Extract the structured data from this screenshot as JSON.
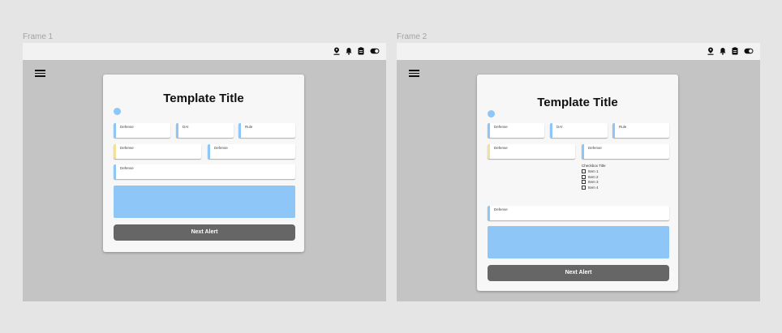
{
  "frames": [
    {
      "label": "Frame 1",
      "icons": [
        "map-pin-icon",
        "bell-icon",
        "clipboard-icon",
        "toggle-icon"
      ],
      "card": {
        "title": "Template Title",
        "fields": [
          {
            "label": "Defense"
          },
          {
            "label": "DAI"
          },
          {
            "label": "Rule"
          },
          {
            "label": "Defense"
          },
          {
            "label": "Defense"
          },
          {
            "label": "Defense"
          }
        ],
        "button": "Next Alert"
      }
    },
    {
      "label": "Frame 2",
      "icons": [
        "map-pin-icon",
        "bell-icon",
        "clipboard-icon",
        "toggle-icon"
      ],
      "card": {
        "title": "Template Title",
        "fields": [
          {
            "label": "Defense"
          },
          {
            "label": "DAI"
          },
          {
            "label": "Rule"
          },
          {
            "label": "Defense"
          },
          {
            "label": "Defense"
          },
          {
            "label": "Defense"
          }
        ],
        "checkbox_title": "Checkbox Title",
        "checkbox_items": [
          "Item 1",
          "Item 2",
          "Item 3",
          "Item 4"
        ],
        "button": "Next Alert"
      }
    }
  ],
  "colors": {
    "accent_blue": "#8ec6f7",
    "accent_yellow": "#f2e19a",
    "button": "#666666",
    "frame_bg": "#c4c4c4",
    "page_bg": "#e5e5e5"
  }
}
